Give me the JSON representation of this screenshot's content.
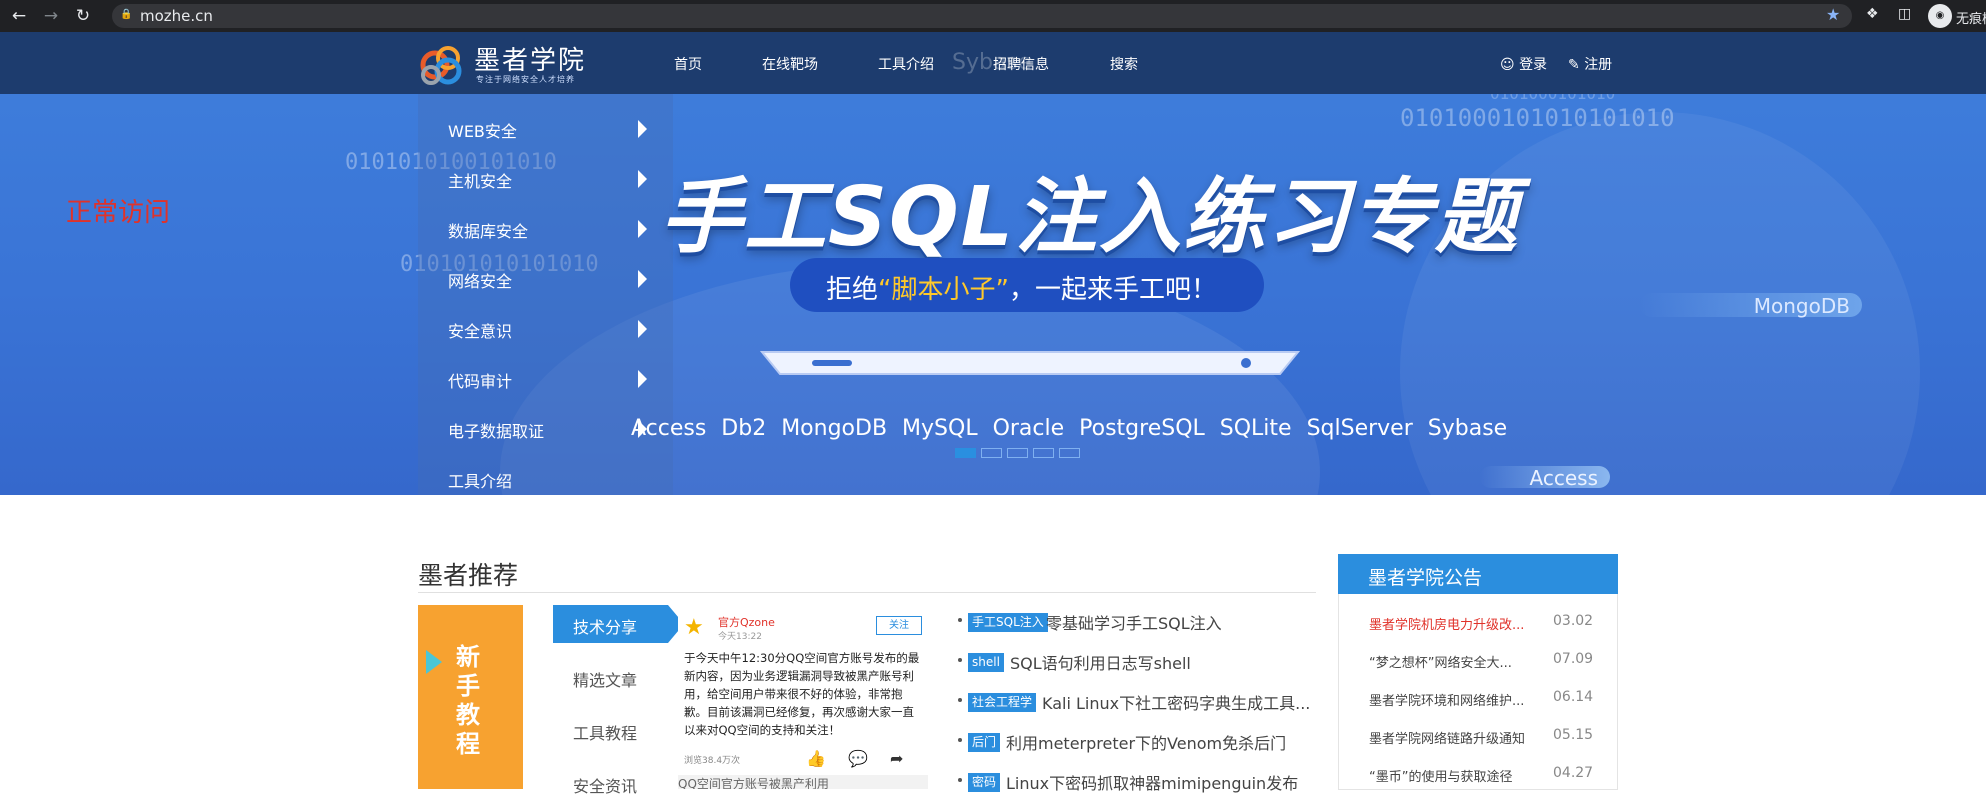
{
  "browser": {
    "url": "mozhe.cn",
    "profile_name": "无痕模式"
  },
  "site": {
    "logo_title": "墨者学院",
    "logo_subtitle": "专注于网络安全人才培养"
  },
  "nav": {
    "items": [
      "首页",
      "在线靶场",
      "工具介绍",
      "招聘信息",
      "搜索"
    ],
    "login": "登录",
    "register": "注册"
  },
  "side_menu": {
    "items": [
      "WEB安全",
      "主机安全",
      "数据库安全",
      "网络安全",
      "安全意识",
      "代码审计",
      "电子数据取证",
      "工具介绍"
    ]
  },
  "banner": {
    "headline": "手工SQL注入练习专题",
    "tagline_prefix": "拒绝",
    "tagline_highlight": "“脚本小子”",
    "tagline_suffix": "，一起来手工吧！",
    "databases": "Access  Db2  MongoDB  MySQL  Oracle  PostgreSQL  SQLite  SqlServer  Sybase",
    "tag_mongodb": "MongoDB",
    "tag_access": "Access",
    "tag_sybase": "Sybase",
    "binary_1": "0101000101010101010",
    "binary_2": "0101010100101010",
    "binary_3": "010101010101010",
    "binary_4": "0101000101010",
    "active_slide": 0,
    "slide_count": 5
  },
  "annotation": {
    "normal_access": "正常访问"
  },
  "recommend": {
    "title": "墨者推荐",
    "newbie_label": "新手教程",
    "tabs": [
      "技术分享",
      "精选文章",
      "工具教程",
      "安全资讯"
    ],
    "active_tab": 0,
    "card": {
      "account": "官方Qzone",
      "time": "今天13:22",
      "follow": "关注",
      "body": "于今天中午12:30分QQ空间官方账号发布的最新内容，因为业务逻辑漏洞导致被黑产账号利用，给空间用户带来很不好的体验，非常抱歉。目前该漏洞已经修复，再次感谢大家一直以来对QQ空间的支持和关注！",
      "views": "浏览38.4万次",
      "next_title": "QQ空间官方账号被黑产利用"
    },
    "articles": [
      {
        "tag": "手工SQL注入",
        "title": "零基础学习手工SQL注入"
      },
      {
        "tag": "shell",
        "title": "SQL语句利用日志写shell"
      },
      {
        "tag": "社会工程学",
        "title": "Kali Linux下社工密码字典生成工具..."
      },
      {
        "tag": "后门",
        "title": "利用meterpreter下的Venom免杀后门"
      },
      {
        "tag": "密码",
        "title": "Linux下密码抓取神器mimipenguin发布"
      }
    ]
  },
  "notices": {
    "title": "墨者学院公告",
    "items": [
      {
        "title": "墨者学院机房电力升级改...",
        "date": "03.02"
      },
      {
        "title": "“梦之想杯”网络安全大...",
        "date": "07.09"
      },
      {
        "title": "墨者学院环境和网络维护...",
        "date": "06.14"
      },
      {
        "title": "墨者学院网络链路升级通知",
        "date": "05.15"
      },
      {
        "title": "“墨币”的使用与获取途径",
        "date": "04.27"
      }
    ]
  },
  "colors": {
    "accent": "#2b8ede",
    "banner_blue": "#3a74d6",
    "topbar": "#1d3c6e",
    "highlight_yellow": "#ffc92a",
    "alert_red": "#e0322a",
    "newbie_orange": "#f7a230"
  }
}
